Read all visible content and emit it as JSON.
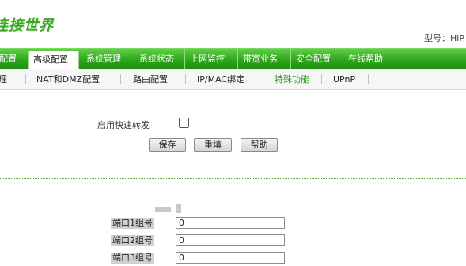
{
  "brand": {
    "logo_text": "连接世界"
  },
  "header": {
    "model_text": "型号：HiP"
  },
  "nav": {
    "items": [
      {
        "label": "配置"
      },
      {
        "label": "高级配置"
      },
      {
        "label": "系统管理"
      },
      {
        "label": "系统状态"
      },
      {
        "label": "上网监控"
      },
      {
        "label": "带宽业务"
      },
      {
        "label": "安全配置"
      },
      {
        "label": "在线帮助"
      }
    ],
    "active_index": 1
  },
  "subnav": {
    "items": [
      {
        "label": "理"
      },
      {
        "label": "NAT和DMZ配置"
      },
      {
        "label": "路由配置"
      },
      {
        "label": "IP/MAC绑定"
      },
      {
        "label": "特殊功能"
      },
      {
        "label": "UPnP"
      }
    ],
    "active_index": 4
  },
  "form": {
    "fast_forward_label": "启用快速转发",
    "fast_forward_checked": false,
    "buttons": {
      "save": "保存",
      "reset": "重填",
      "help": "帮助"
    }
  },
  "ports": {
    "rows": [
      {
        "label": "端口1组号",
        "value": "0"
      },
      {
        "label": "端口2组号",
        "value": "0"
      },
      {
        "label": "端口3组号",
        "value": "0"
      }
    ]
  },
  "colors": {
    "accent": "#2ea51c",
    "subnav_active": "#2f9a20"
  }
}
